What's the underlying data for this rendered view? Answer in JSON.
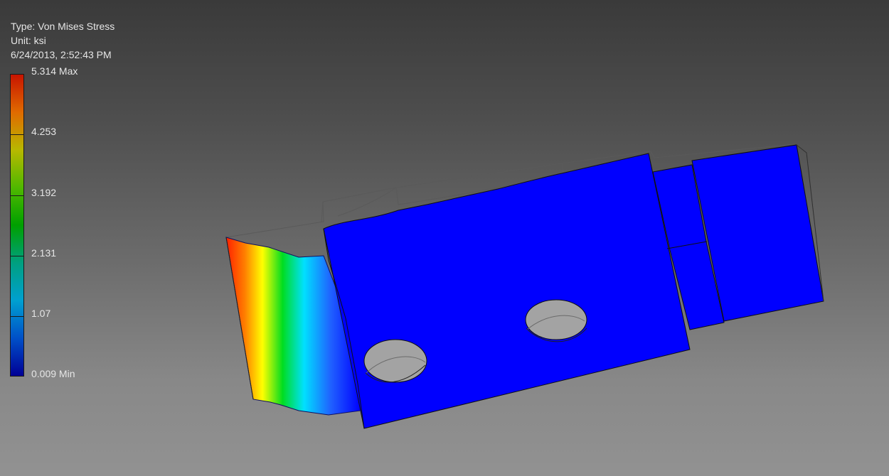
{
  "result_header": {
    "type_line": "Type: Von Mises Stress",
    "unit_line": "Unit: ksi",
    "date_line": "6/24/2013, 2:52:43 PM"
  },
  "legend": {
    "max_label": "5.314 Max",
    "tick_2": "4.253",
    "tick_3": "3.192",
    "tick_4": "2.131",
    "tick_5": "1.07",
    "min_label": "0.009 Min",
    "colors": [
      "#c81400",
      "#e06a00",
      "#b8b800",
      "#50b800",
      "#00a000",
      "#00a080",
      "#00a0d0",
      "#0050c8",
      "#000096"
    ]
  },
  "model": {
    "part_color": "#0000ff",
    "hole_color": "#a3a3a3",
    "hot_color": "#ff2000",
    "mid_color": "#ffff00",
    "warm_color": "#00dd20",
    "cool_color": "#00e0ff"
  }
}
